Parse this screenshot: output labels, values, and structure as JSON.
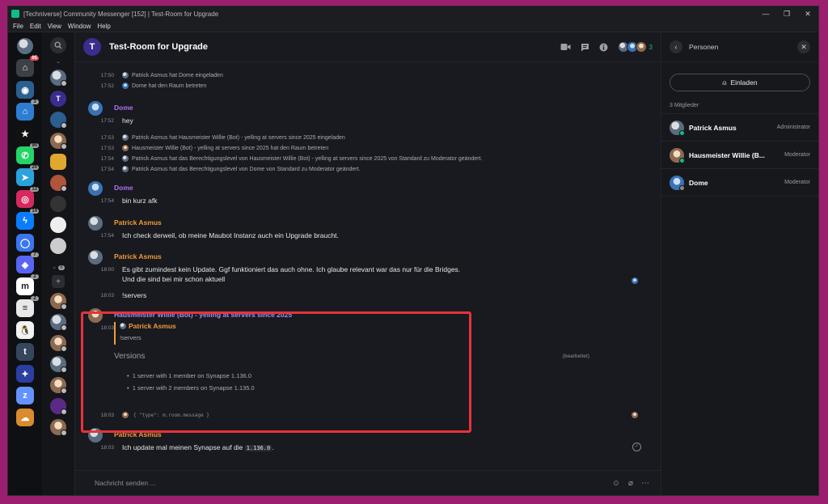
{
  "window": {
    "title": "[Techniverse] Community Messenger [152] | Test-Room for Upgrade",
    "controls": [
      "—",
      "❐",
      "✕"
    ]
  },
  "menu": [
    "File",
    "Edit",
    "View",
    "Window",
    "Help"
  ],
  "spaces": [
    {
      "name": "home",
      "badge": "95",
      "badge_red": true,
      "color": "#3d4046",
      "glyph": "⌂"
    },
    {
      "name": "techniverse",
      "badge": "",
      "color": "#2b5f8f",
      "glyph": "◉"
    },
    {
      "name": "home2",
      "badge": "3",
      "color": "#2d7dd2",
      "glyph": "⌂"
    },
    {
      "name": "star",
      "badge": "",
      "color": "#111111",
      "glyph": "★"
    },
    {
      "name": "whatsapp",
      "badge": "90",
      "color": "#25d366",
      "glyph": "✆"
    },
    {
      "name": "telegram",
      "badge": "20",
      "color": "#2aa2dd",
      "glyph": "➤"
    },
    {
      "name": "instagram",
      "badge": "13",
      "color": "#d6295f",
      "glyph": "◎"
    },
    {
      "name": "messenger",
      "badge": "14",
      "color": "#0a7cff",
      "glyph": "ϟ"
    },
    {
      "name": "signal",
      "badge": "",
      "color": "#3a76f0",
      "glyph": "◯"
    },
    {
      "name": "discord",
      "badge": "7",
      "color": "#5865f2",
      "glyph": "◈"
    },
    {
      "name": "matrix",
      "badge": "2",
      "color": "#ffffff",
      "glyph": "m"
    },
    {
      "name": "bridge",
      "badge": "2",
      "color": "#e8e8e8",
      "glyph": "≡"
    },
    {
      "name": "linux",
      "badge": "",
      "color": "#f2f2f2",
      "glyph": "🐧"
    },
    {
      "name": "tumblr",
      "badge": "",
      "color": "#36465d",
      "glyph": "t"
    },
    {
      "name": "tweet",
      "badge": "",
      "color": "#2a3fa0",
      "glyph": "✦"
    },
    {
      "name": "zulip",
      "badge": "",
      "color": "#6492fe",
      "glyph": "z"
    },
    {
      "name": "cloud",
      "badge": "",
      "color": "#d98b2e",
      "glyph": "☁"
    }
  ],
  "rooms_badges": [
    "6",
    "2",
    "2",
    "2",
    "2"
  ],
  "room": {
    "avatar_letter": "T",
    "name": "Test-Room for Upgrade",
    "member_count": "3"
  },
  "timeline": {
    "e1_time": "17:50",
    "e1_text": "Patrick Asmus hat Dome eingeladen",
    "e2_time": "17:52",
    "e2_text": "Dome hat den Raum betreten",
    "m1_sender": "Dome",
    "m1_time": "17:52",
    "m1_text": "hey",
    "e3_time": "17:53",
    "e3_text": "Patrick Asmus hat Hausmeister Willie (Bot) - yelling at servers since 2025 eingeladen",
    "e4_time": "17:53",
    "e4_text": "Hausmeister Willie (Bot) - yelling at servers since 2025 hat den Raum betreten",
    "e5_time": "17:54",
    "e5_text": "Patrick Asmus hat das Berechtigungslevel von Hausmeister Willie (Bot) - yelling at servers since 2025 von Standard zu Moderator geändert.",
    "e6_time": "17:54",
    "e6_text": "Patrick Asmus hat das Berechtigungslevel von Dome von Standard zu Moderator geändert.",
    "m2_sender": "Dome",
    "m2_time": "17:54",
    "m2_text": "bin kurz afk",
    "m3_sender": "Patrick Asmus",
    "m3_time": "17:54",
    "m3_text": "Ich check derweil, ob meine Maubot Instanz auch ein Upgrade braucht.",
    "m4_sender": "Patrick Asmus",
    "m4_time": "18:00",
    "m4_text": "Es gibt zumindest kein Update. Ggf funktioniert das auch ohne. Ich glaube relevant war das nur für die Bridges.",
    "m4_text2": "Und die sind bei mir schon aktuell",
    "m5_time": "18:03",
    "m5_text": "!servers",
    "bot_sender": "Hausmeister Willie (Bot) - yelling at servers since 2025",
    "bot_time": "18:03",
    "reply_sender": "Patrick Asmus",
    "reply_text": "!servers",
    "versions_title": "Versions",
    "edited": "(bearbeitet)",
    "bullet1": "1 server with 1 member on Synapse 1.136.0",
    "bullet2": "1 server with 2 members on Synapse 1.135.0",
    "hidden_time": "18:03",
    "hidden_text": "{ \"type\": m.room.message }",
    "m6_sender": "Patrick Asmus",
    "m6_time": "18:03",
    "m6_text_pre": "Ich update mal meinen Synapse auf die ",
    "m6_code": "1.136.0",
    "m6_text_post": "."
  },
  "composer": {
    "placeholder": "Nachricht senden ..."
  },
  "right_panel": {
    "title": "Personen",
    "invite_label": "Einladen",
    "members_count": "3 Mitglieder",
    "members": [
      {
        "name": "Patrick Asmus",
        "role": "Administrator"
      },
      {
        "name": "Hausmeister Willie (B...",
        "role": "Moderator"
      },
      {
        "name": "Dome",
        "role": "Moderator"
      }
    ]
  }
}
